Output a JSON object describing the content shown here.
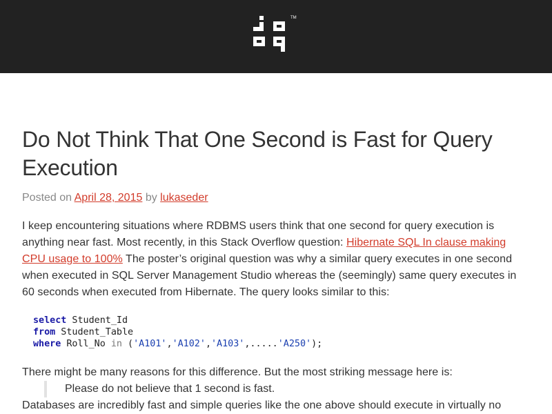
{
  "header": {
    "logo_icon": "jooq-logo-icon",
    "logo_mark": "TM"
  },
  "post": {
    "title": "Do Not Think That One Second is Fast for Query Execution",
    "meta": {
      "posted_on": "Posted on",
      "date": "April 28, 2015",
      "by": "by",
      "author": "lukaseder"
    },
    "para1_before": "I keep encountering situations where RDBMS users think that one second for query execution is anything near fast. Most recently, in this Stack Overflow question: ",
    "para1_link": "Hibernate SQL In clause making CPU usage to 100%",
    "para1_after": " The poster’s original question was why a similar query executes in one second when executed in SQL Server Management Studio whereas the (seemingly) same query executes in 60 seconds when executed from Hibernate. The query looks similar to this:",
    "code": {
      "l1_kw": "select",
      "l1_rest": " Student_Id",
      "l2_kw": "from",
      "l2_rest": " Student_Table",
      "l3_kw": "where",
      "l3_a": " Roll_No ",
      "l3_in": "in",
      "l3_b": " (",
      "l3_s1": "'A101'",
      "l3_c1": ",",
      "l3_s2": "'A102'",
      "l3_c2": ",",
      "l3_s3": "'A103'",
      "l3_c3": ",.....",
      "l3_s4": "'A250'",
      "l3_end": ");"
    },
    "para2": "There might be many reasons for this difference. But the most striking message here is:",
    "quote": "Please do not believe that 1 second is fast.",
    "para3": "Databases are incredibly fast and simple queries like the one above should execute in virtually no"
  },
  "colors": {
    "header_bg": "#222222",
    "link": "#d23b2a",
    "meta": "#888888",
    "keyword": "#1a1aa6"
  }
}
